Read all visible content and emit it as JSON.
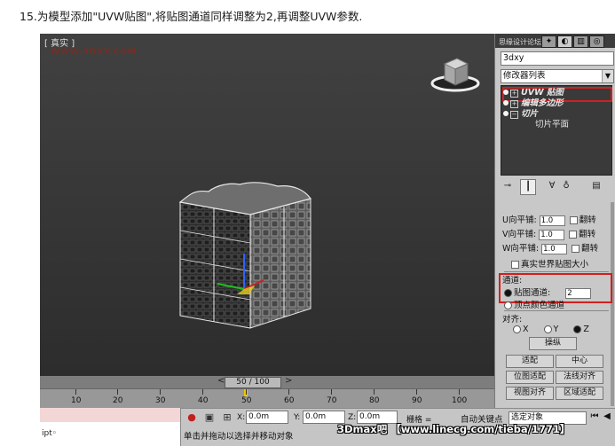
{
  "caption": "15.为模型添加\"UVW贴图\",将贴图通道同样调整为2,再调整UVW参数.",
  "viewport": {
    "label": "[ 真实 ]",
    "watermark": "WWW.3DXY.COM"
  },
  "timeslider": {
    "position": "50 / 100",
    "prev": "<",
    "next": ">"
  },
  "ruler": {
    "ticks": [
      "10",
      "20",
      "30",
      "40",
      "50",
      "60",
      "70",
      "80",
      "90",
      "100"
    ]
  },
  "maxscript": {
    "prompt": "ipt◦"
  },
  "status": {
    "hint": "单击并拖动以选择并移动对象",
    "x_label": "X:",
    "x_value": "0.0m",
    "y_label": "Y:",
    "y_value": "0.0m",
    "z_label": "Z:",
    "z_value": "0.0m",
    "grid": "栅格 =",
    "autokey": "自动关键点",
    "selection": "选定对象"
  },
  "watermark_bottom": "3Dmax吧 【www.linecg.com/tieba/1771】",
  "panel": {
    "header_wm": "思缘设计论坛",
    "object_name": "3dxy",
    "modifier_list": "修改器列表",
    "stack": [
      {
        "label": "UVW 贴图",
        "highlight": true
      },
      {
        "label": "编辑多边形",
        "highlight": false
      },
      {
        "label": "切片",
        "highlight": false
      },
      {
        "label": "切片平面",
        "highlight": false
      }
    ],
    "params": {
      "u_tile_label": "U向平铺:",
      "u_tile": "1.0",
      "u_flip": "翻转",
      "v_tile_label": "V向平铺:",
      "v_tile": "1.0",
      "v_flip": "翻转",
      "w_tile_label": "W向平铺:",
      "w_tile": "1.0",
      "w_flip": "翻转",
      "real_world": "真实世界贴图大小",
      "channel_group": "通道:",
      "map_channel_label": "贴图通道:",
      "map_channel_value": "2",
      "vertex_color": "顶点颜色通道",
      "align_group": "对齐:",
      "axis_x": "X",
      "axis_y": "Y",
      "axis_z": "Z",
      "manipulate": "操纵",
      "fit": "适配",
      "center": "中心",
      "bitmap_fit": "位图适配",
      "normal_align": "法线对齐",
      "view_align": "视图对齐",
      "region_fit": "区域适配"
    }
  },
  "colors": {
    "highlight_red": "#d02020",
    "viewport_bg": "#363636"
  }
}
